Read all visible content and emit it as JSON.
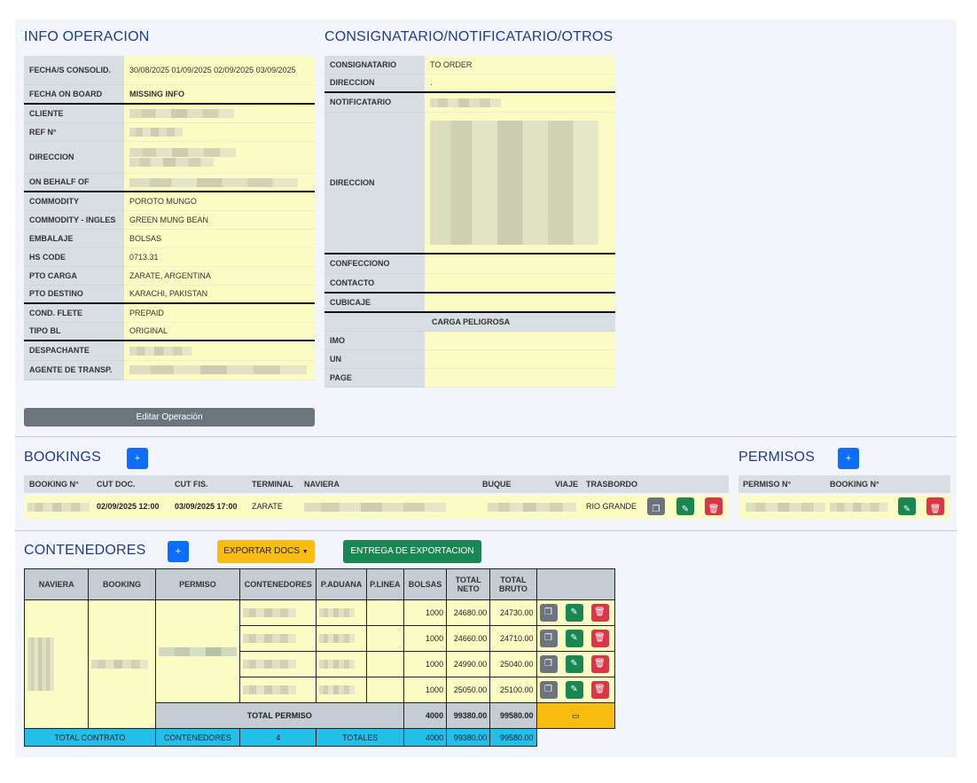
{
  "info": {
    "title": "INFO OPERACION",
    "rows": [
      {
        "k": "FECHA/S CONSOLID.",
        "v": "30/08/2025 01/09/2025 02/09/2025 03/09/2025"
      },
      {
        "k": "FECHA ON BOARD",
        "v": "MISSING INFO"
      },
      {
        "k": "CLIENTE",
        "v": ""
      },
      {
        "k": "REF N°",
        "v": ""
      },
      {
        "k": "DIRECCION",
        "v": ""
      },
      {
        "k": "ON BEHALF OF",
        "v": ""
      },
      {
        "k": "COMMODITY",
        "v": "POROTO MUNGO"
      },
      {
        "k": "COMMODITY - INGLES",
        "v": "GREEN MUNG BEAN"
      },
      {
        "k": "EMBALAJE",
        "v": "BOLSAS"
      },
      {
        "k": "HS CODE",
        "v": "0713.31"
      },
      {
        "k": "PTO CARGA",
        "v": "ZARATE, ARGENTINA"
      },
      {
        "k": "PTO DESTINO",
        "v": "KARACHI, PAKISTAN"
      },
      {
        "k": "COND. FLETE",
        "v": "PREPAID"
      },
      {
        "k": "TIPO BL",
        "v": "ORIGINAL"
      },
      {
        "k": "DESPACHANTE",
        "v": ""
      },
      {
        "k": "AGENTE DE TRANSP.",
        "v": ""
      }
    ],
    "edit_button": "Editar Operación"
  },
  "consig": {
    "title": "CONSIGNATARIO/NOTIFICATARIO/OTROS",
    "rows": [
      {
        "k": "CONSIGNATARIO",
        "v": "TO ORDER"
      },
      {
        "k": "DIRECCION",
        "v": "."
      },
      {
        "k": "NOTIFICATARIO",
        "v": ""
      },
      {
        "k": "DIRECCION",
        "v": ""
      },
      {
        "k": "CONFECCIONO",
        "v": ""
      },
      {
        "k": "CONTACTO",
        "v": ""
      },
      {
        "k": "CUBICAJE",
        "v": ""
      },
      {
        "k": "IMO",
        "v": ""
      },
      {
        "k": "UN",
        "v": ""
      },
      {
        "k": "PAGE",
        "v": ""
      }
    ],
    "carga_peligrosa": "CARGA PELIGROSA"
  },
  "bookings": {
    "title": "BOOKINGS",
    "add": "+",
    "headers": [
      "BOOKING N°",
      "CUT DOC.",
      "CUT FIS.",
      "TERMINAL",
      "NAVIERA",
      "BUQUE",
      "VIAJE",
      "TRASBORDO"
    ],
    "row": {
      "cut_doc": "02/09/2025 12:00",
      "cut_fis": "03/09/2025 17:00",
      "terminal": "ZARATE",
      "trasbordo": "RIO GRANDE"
    }
  },
  "permisos": {
    "title": "PERMISOS",
    "add": "+",
    "headers": [
      "PERMISO N°",
      "BOOKING N°"
    ]
  },
  "contenedores": {
    "title": "CONTENEDORES",
    "add": "+",
    "export_docs": "EXPORTAR DOCS",
    "entrega": "ENTREGA DE EXPORTACION",
    "headers": [
      "NAVIERA",
      "BOOKING",
      "PERMISO",
      "CONTENEDORES",
      "P.ADUANA",
      "P.LINEA",
      "BOLSAS",
      "TOTAL NETO",
      "TOTAL BRUTO"
    ],
    "rows": [
      {
        "bolsas": "1000",
        "neto": "24680.00",
        "bruto": "24730.00"
      },
      {
        "bolsas": "1000",
        "neto": "24660.00",
        "bruto": "24710.00"
      },
      {
        "bolsas": "1000",
        "neto": "24990.00",
        "bruto": "25040.00"
      },
      {
        "bolsas": "1000",
        "neto": "25050.00",
        "bruto": "25100.00"
      }
    ],
    "total_permiso": {
      "label": "TOTAL PERMISO",
      "bolsas": "4000",
      "neto": "99380.00",
      "bruto": "99580.00"
    },
    "total_contrato": {
      "label": "TOTAL CONTRATO",
      "cont_label": "CONTENEDORES",
      "cont_count": "4",
      "totales": "TOTALES",
      "bolsas": "4000",
      "neto": "99380.00",
      "bruto": "99580.00"
    }
  }
}
